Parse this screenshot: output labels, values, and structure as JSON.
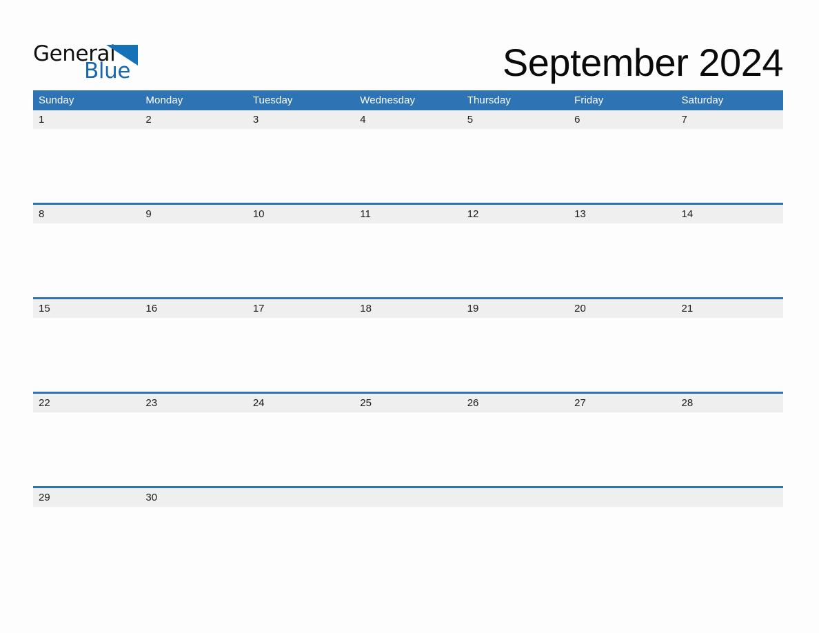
{
  "brand": {
    "name_part1": "General",
    "name_part2": "Blue",
    "triangle_color": "#1572b8",
    "text_color_primary": "#100f0d",
    "text_color_accent": "#1667b0"
  },
  "header": {
    "title": "September 2024",
    "month": "September",
    "year": "2024"
  },
  "theme": {
    "header_blue": "#2e74b5",
    "date_strip_gray": "#efefef",
    "page_background": "#fdfdfd",
    "header_text": "#ffffff",
    "date_text": "#1a1a1a"
  },
  "calendar": {
    "weekday_headers": [
      "Sunday",
      "Monday",
      "Tuesday",
      "Wednesday",
      "Thursday",
      "Friday",
      "Saturday"
    ],
    "weeks": [
      {
        "dates": [
          "1",
          "2",
          "3",
          "4",
          "5",
          "6",
          "7"
        ]
      },
      {
        "dates": [
          "8",
          "9",
          "10",
          "11",
          "12",
          "13",
          "14"
        ]
      },
      {
        "dates": [
          "15",
          "16",
          "17",
          "18",
          "19",
          "20",
          "21"
        ]
      },
      {
        "dates": [
          "22",
          "23",
          "24",
          "25",
          "26",
          "27",
          "28"
        ]
      },
      {
        "dates": [
          "29",
          "30",
          "",
          "",
          "",
          "",
          ""
        ]
      }
    ]
  }
}
